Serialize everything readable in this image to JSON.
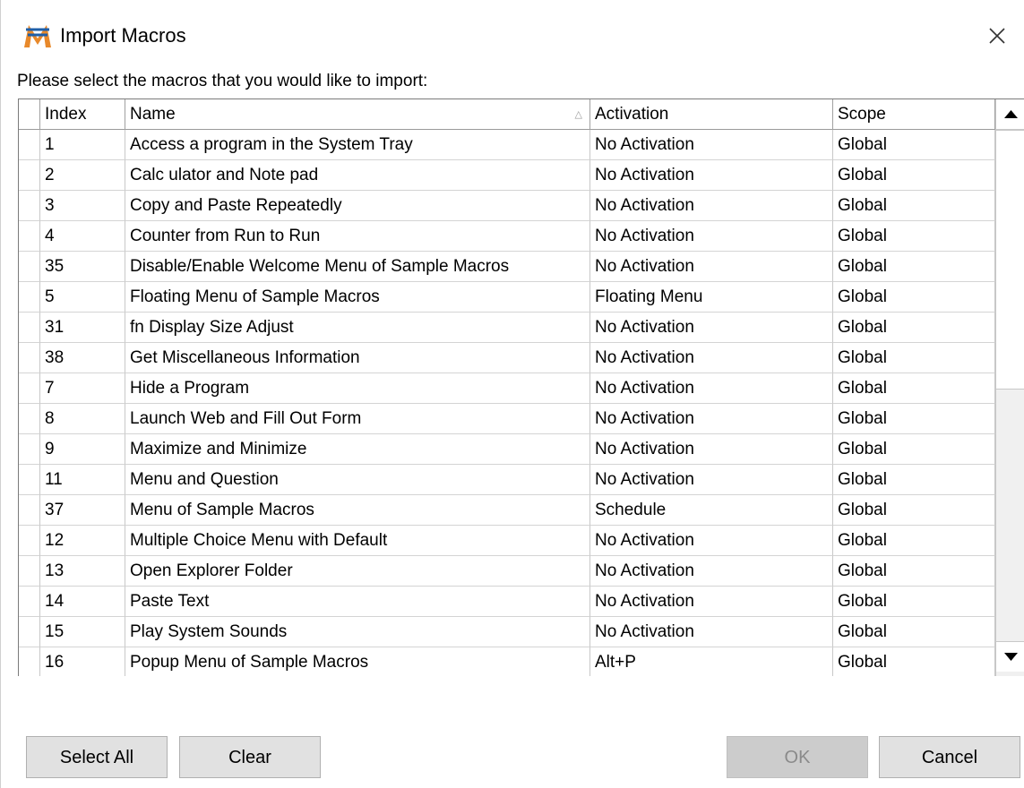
{
  "window": {
    "title": "Import Macros",
    "prompt": "Please select the macros that you would like to import:"
  },
  "table": {
    "columns": [
      "Index",
      "Name",
      "Activation",
      "Scope"
    ],
    "rows": [
      {
        "index": "1",
        "name": "Access a program in the System Tray",
        "activation": "No Activation",
        "scope": "Global"
      },
      {
        "index": "2",
        "name": "Calc ulator and Note pad",
        "activation": "No Activation",
        "scope": "Global"
      },
      {
        "index": "3",
        "name": "Copy and Paste Repeatedly",
        "activation": "No Activation",
        "scope": "Global"
      },
      {
        "index": "4",
        "name": "Counter from Run to Run",
        "activation": "No Activation",
        "scope": "Global"
      },
      {
        "index": "35",
        "name": "Disable/Enable Welcome Menu of Sample Macros",
        "activation": "No Activation",
        "scope": "Global"
      },
      {
        "index": "5",
        "name": "Floating Menu of Sample Macros",
        "activation": "Floating Menu",
        "scope": "Global"
      },
      {
        "index": "31",
        "name": "fn Display Size Adjust",
        "activation": "No Activation",
        "scope": "Global"
      },
      {
        "index": "38",
        "name": "Get Miscellaneous Information",
        "activation": "No Activation",
        "scope": "Global"
      },
      {
        "index": "7",
        "name": "Hide a Program",
        "activation": "No Activation",
        "scope": "Global"
      },
      {
        "index": "8",
        "name": "Launch Web and Fill Out Form",
        "activation": "No Activation",
        "scope": "Global"
      },
      {
        "index": "9",
        "name": "Maximize and Minimize",
        "activation": "No Activation",
        "scope": "Global"
      },
      {
        "index": "11",
        "name": "Menu and Question",
        "activation": "No Activation",
        "scope": "Global"
      },
      {
        "index": "37",
        "name": "Menu of Sample Macros",
        "activation": "Schedule",
        "scope": "Global"
      },
      {
        "index": "12",
        "name": "Multiple Choice Menu with Default",
        "activation": "No Activation",
        "scope": "Global"
      },
      {
        "index": "13",
        "name": "Open Explorer Folder",
        "activation": "No Activation",
        "scope": "Global"
      },
      {
        "index": "14",
        "name": "Paste Text",
        "activation": "No Activation",
        "scope": "Global"
      },
      {
        "index": "15",
        "name": "Play System Sounds",
        "activation": "No Activation",
        "scope": "Global"
      },
      {
        "index": "16",
        "name": "Popup Menu of Sample Macros",
        "activation": "Alt+P",
        "scope": "Global"
      }
    ]
  },
  "buttons": {
    "select_all": "Select All",
    "clear": "Clear",
    "ok": "OK",
    "cancel": "Cancel"
  },
  "colors": {
    "icon_orange": "#e8892b",
    "icon_blue": "#1f5fa8",
    "ok_disabled_text": "#8a8a8a"
  }
}
